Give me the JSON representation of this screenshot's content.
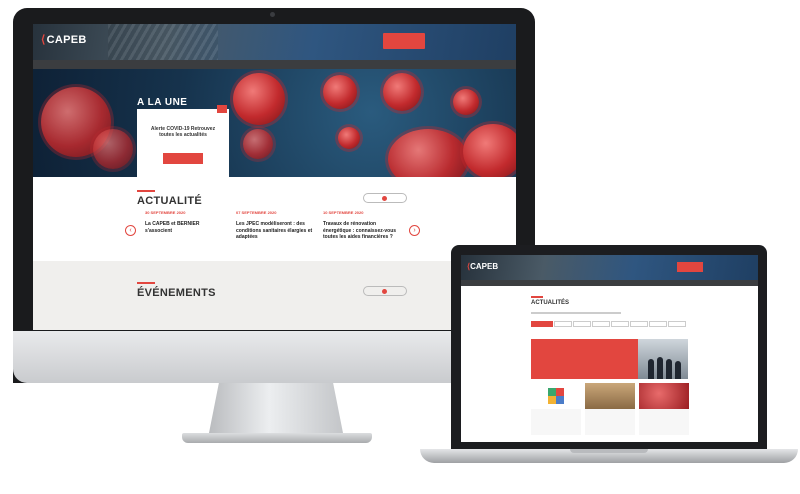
{
  "desktop": {
    "header": {
      "logo": "CAPEB",
      "subtitle": "",
      "cta_label": "",
      "link_label": ""
    },
    "nav": {
      "items": [
        "",
        "",
        "",
        "",
        "",
        ""
      ],
      "search_label": ""
    },
    "hero": {
      "section_title": "A LA UNE",
      "card_text": "Alerte COVID-19 Retrouvez toutes les actualités",
      "card_button": ""
    },
    "actualite": {
      "title": "ACTUALITÉ",
      "see_all": "",
      "prev": "‹",
      "next": "›",
      "items": [
        {
          "date": "30 SEPTEMBRE 2020",
          "title": "La CAPEB et BERNIER s'associent"
        },
        {
          "date": "07 SEPTEMBRE 2020",
          "title": "Les JPEC modéliseront : des conditions sanitaires élargies et adaptées"
        },
        {
          "date": "10 SEPTEMBRE 2020",
          "title": "Travaux de rénovation énergétique : connaissez-vous toutes les aides financières ?"
        }
      ]
    },
    "evenements": {
      "title": "ÉVÉNEMENTS",
      "see_all": ""
    }
  },
  "laptop": {
    "header": {
      "logo": "CAPEB",
      "subtitle": "",
      "cta_label": ""
    },
    "page_title": "ACTUALITÉS",
    "filters": [
      "",
      "",
      "",
      "",
      "",
      "",
      "",
      ""
    ],
    "featured_text": "",
    "cards": [
      {
        "tag": "",
        "text": ""
      },
      {
        "tag": "",
        "text": ""
      },
      {
        "tag": "",
        "text": ""
      }
    ]
  },
  "colors": {
    "accent": "#e2463f",
    "header_dark": "#27323c",
    "nav_bg": "#3b3d40"
  }
}
